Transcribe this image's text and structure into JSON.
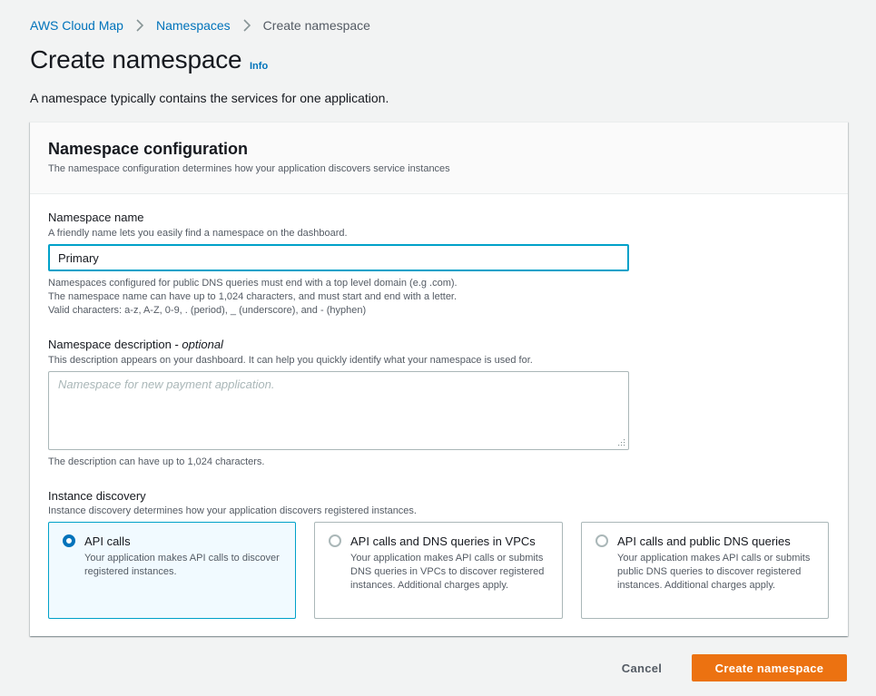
{
  "breadcrumb": {
    "items": [
      {
        "label": "AWS Cloud Map"
      },
      {
        "label": "Namespaces"
      },
      {
        "label": "Create namespace"
      }
    ]
  },
  "page": {
    "title": "Create namespace",
    "info_label": "Info",
    "description": "A namespace typically contains the services for one application."
  },
  "panel": {
    "title": "Namespace configuration",
    "subtitle": "The namespace configuration determines how your application discovers service instances"
  },
  "name_field": {
    "label": "Namespace name",
    "description": "A friendly name lets you easily find a namespace on the dashboard.",
    "value": "Primary",
    "hints": [
      "Namespaces configured for public DNS queries must end with a top level domain (e.g .com).",
      "The namespace name can have up to 1,024 characters, and must start and end with a letter.",
      "Valid characters: a-z, A-Z, 0-9, . (period), _ (underscore), and - (hyphen)"
    ]
  },
  "description_field": {
    "label": "Namespace description - ",
    "label_optional": "optional",
    "description": "This description appears on your dashboard. It can help you quickly identify what your namespace is used for.",
    "placeholder": "Namespace for new payment application.",
    "value": "",
    "hint": "The description can have up to 1,024 characters."
  },
  "discovery": {
    "label": "Instance discovery",
    "description": "Instance discovery determines how your application discovers registered instances.",
    "options": [
      {
        "title": "API calls",
        "description": "Your application makes API calls to discover registered instances.",
        "selected": true
      },
      {
        "title": "API calls and DNS queries in VPCs",
        "description": "Your application makes API calls or submits DNS queries in VPCs to discover registered instances. Additional charges apply.",
        "selected": false
      },
      {
        "title": "API calls and public DNS queries",
        "description": "Your application makes API calls or submits public DNS queries to discover registered instances. Additional charges apply.",
        "selected": false
      }
    ]
  },
  "footer": {
    "cancel_label": "Cancel",
    "create_label": "Create namespace"
  },
  "colors": {
    "link": "#0073bb",
    "primary_button": "#ec7211",
    "focus_border": "#00a1c9",
    "selected_tile_bg": "#f1faff"
  }
}
